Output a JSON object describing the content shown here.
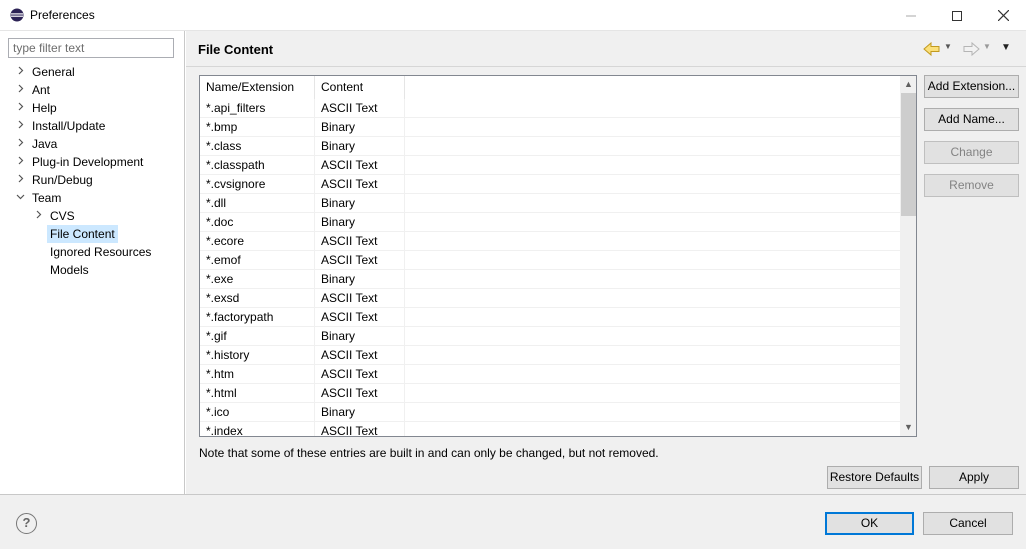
{
  "window": {
    "title": "Preferences",
    "minimize_icon": "minimize-icon",
    "maximize_icon": "maximize-icon",
    "close_icon": "close-icon"
  },
  "filter": {
    "placeholder": "type filter text",
    "value": ""
  },
  "tree": [
    {
      "label": "General",
      "expanded": false,
      "level": 0,
      "selected": false
    },
    {
      "label": "Ant",
      "expanded": false,
      "level": 0,
      "selected": false
    },
    {
      "label": "Help",
      "expanded": false,
      "level": 0,
      "selected": false
    },
    {
      "label": "Install/Update",
      "expanded": false,
      "level": 0,
      "selected": false
    },
    {
      "label": "Java",
      "expanded": false,
      "level": 0,
      "selected": false
    },
    {
      "label": "Plug-in Development",
      "expanded": false,
      "level": 0,
      "selected": false
    },
    {
      "label": "Run/Debug",
      "expanded": false,
      "level": 0,
      "selected": false
    },
    {
      "label": "Team",
      "expanded": true,
      "level": 0,
      "selected": false
    },
    {
      "label": "CVS",
      "expanded": false,
      "level": 1,
      "selected": false
    },
    {
      "label": "File Content",
      "expanded": null,
      "level": 1,
      "selected": true
    },
    {
      "label": "Ignored Resources",
      "expanded": null,
      "level": 1,
      "selected": false
    },
    {
      "label": "Models",
      "expanded": null,
      "level": 1,
      "selected": false
    }
  ],
  "page": {
    "title": "File Content",
    "table": {
      "columns": [
        "Name/Extension",
        "Content"
      ],
      "rows": [
        [
          "*.api_filters",
          "ASCII Text"
        ],
        [
          "*.bmp",
          "Binary"
        ],
        [
          "*.class",
          "Binary"
        ],
        [
          "*.classpath",
          "ASCII Text"
        ],
        [
          "*.cvsignore",
          "ASCII Text"
        ],
        [
          "*.dll",
          "Binary"
        ],
        [
          "*.doc",
          "Binary"
        ],
        [
          "*.ecore",
          "ASCII Text"
        ],
        [
          "*.emof",
          "ASCII Text"
        ],
        [
          "*.exe",
          "Binary"
        ],
        [
          "*.exsd",
          "ASCII Text"
        ],
        [
          "*.factorypath",
          "ASCII Text"
        ],
        [
          "*.gif",
          "Binary"
        ],
        [
          "*.history",
          "ASCII Text"
        ],
        [
          "*.htm",
          "ASCII Text"
        ],
        [
          "*.html",
          "ASCII Text"
        ],
        [
          "*.ico",
          "Binary"
        ],
        [
          "*.index",
          "ASCII Text"
        ]
      ]
    },
    "buttons": {
      "add_extension": "Add Extension...",
      "add_name": "Add Name...",
      "change": "Change",
      "remove": "Remove",
      "restore_defaults": "Restore Defaults",
      "apply": "Apply"
    },
    "note": "Note that some of these entries are built in and can only be changed, but not removed."
  },
  "dialog": {
    "ok": "OK",
    "cancel": "Cancel"
  }
}
